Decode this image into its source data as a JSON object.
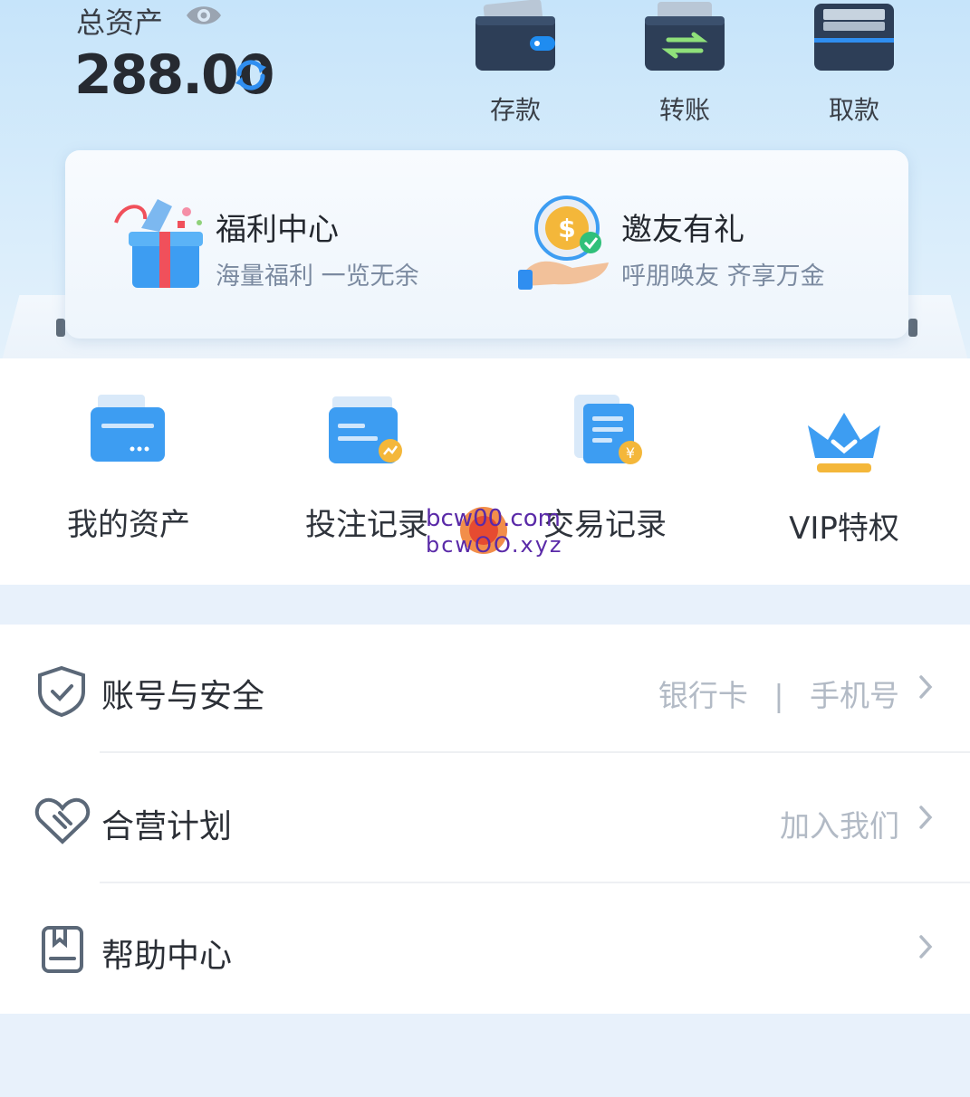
{
  "header": {
    "total_label": "总资产",
    "total_value": "288.00",
    "actions": [
      {
        "label": "存款",
        "icon": "deposit-wallet-icon"
      },
      {
        "label": "转账",
        "icon": "transfer-wallet-icon"
      },
      {
        "label": "取款",
        "icon": "withdraw-wallet-icon"
      }
    ]
  },
  "promos": [
    {
      "title": "福利中心",
      "subtitle": "海量福利 一览无余",
      "icon": "gift-box-icon"
    },
    {
      "title": "邀友有礼",
      "subtitle": "呼朋唤友 齐享万金",
      "icon": "coin-hand-icon"
    }
  ],
  "quick": [
    {
      "label": "我的资产",
      "icon": "asset-card-icon"
    },
    {
      "label": "投注记录",
      "icon": "bet-record-icon"
    },
    {
      "label": "交易记录",
      "icon": "transaction-record-icon"
    },
    {
      "label": "VIP特权",
      "icon": "vip-crown-icon"
    }
  ],
  "watermark": {
    "line1": "bcw00.com",
    "line2": "bcwOO.xyz"
  },
  "menu": [
    {
      "label": "账号与安全",
      "right_a": "银行卡",
      "separator": "|",
      "right_b": "手机号",
      "icon": "shield-icon"
    },
    {
      "label": "合营计划",
      "right": "加入我们",
      "icon": "heart-handshake-icon"
    },
    {
      "label": "帮助中心",
      "icon": "help-book-icon"
    }
  ],
  "colors": {
    "accent": "#2f8ef0",
    "text": "#2b2f36",
    "muted": "#b2bac5"
  }
}
